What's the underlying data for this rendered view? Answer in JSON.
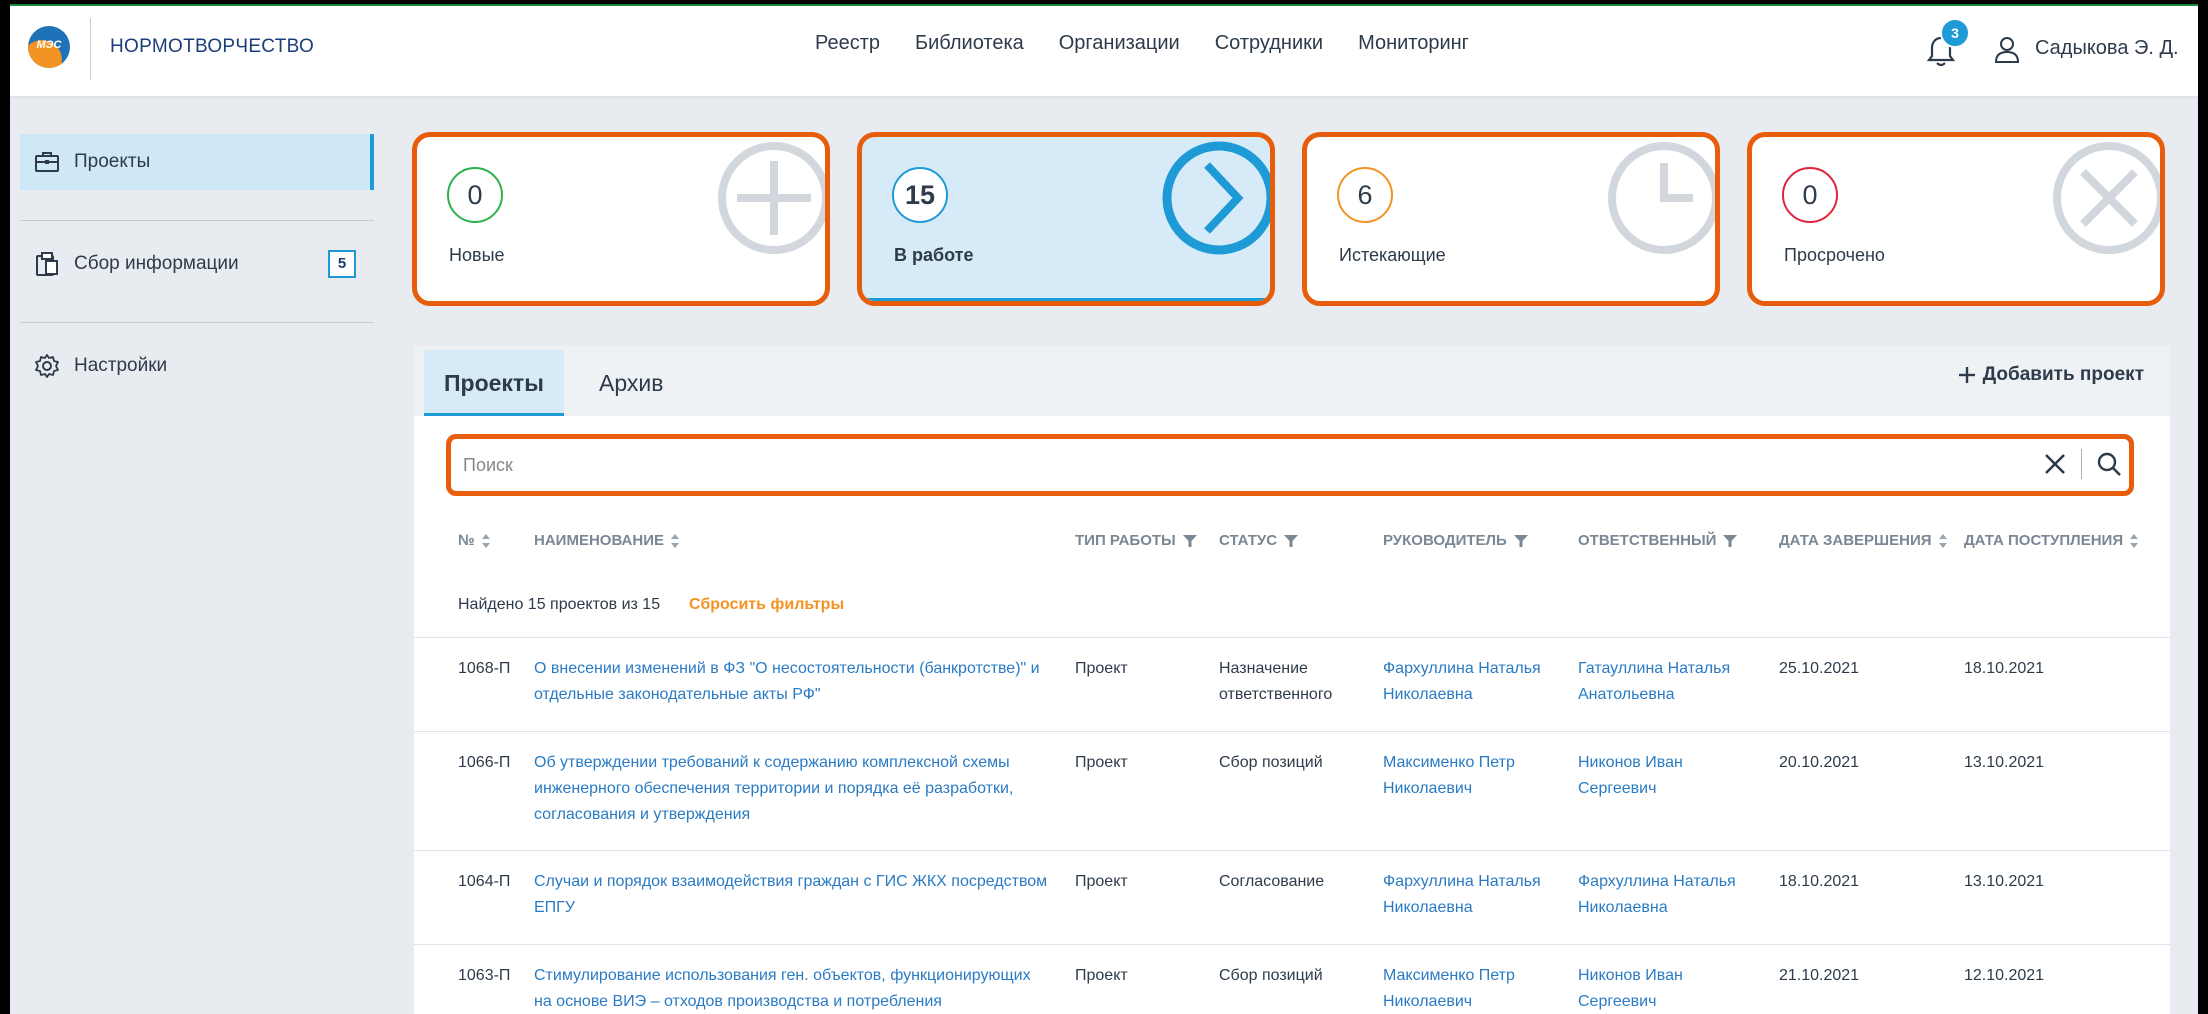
{
  "header": {
    "logo_text": "МЭС",
    "brand": "НОРМОТВОРЧЕСТВО",
    "nav": [
      "Реестр",
      "Библиотека",
      "Организации",
      "Сотрудники",
      "Мониторинг"
    ],
    "notifications_count": "3",
    "user_name": "Садыкова Э. Д."
  },
  "sidebar": {
    "items": [
      {
        "label": "Проекты",
        "icon": "briefcase-icon",
        "active": true
      },
      {
        "label": "Сбор информации",
        "icon": "clipboard-icon",
        "badge": "5"
      },
      {
        "label": "Настройки",
        "icon": "gear-icon"
      }
    ]
  },
  "cards": [
    {
      "count": "0",
      "label": "Новые",
      "icon": "plus-icon",
      "color": "#2bb24c"
    },
    {
      "count": "15",
      "label": "В работе",
      "icon": "chevron-right-icon",
      "color": "#1e9ad6"
    },
    {
      "count": "6",
      "label": "Истекающие",
      "icon": "clock-icon",
      "color": "#f39323"
    },
    {
      "count": "0",
      "label": "Просрочено",
      "icon": "close-icon",
      "color": "#e0243a"
    }
  ],
  "tabs": [
    "Проекты",
    "Архив"
  ],
  "add_project": "Добавить проект",
  "search": {
    "placeholder": "Поиск"
  },
  "table": {
    "columns": [
      "№",
      "НАИМЕНОВАНИЕ",
      "ТИП РАБОТЫ",
      "СТАТУС",
      "РУКОВОДИТЕЛЬ",
      "ОТВЕТСТВЕННЫЙ",
      "ДАТА ЗАВЕРШЕНИЯ",
      "ДАТА ПОСТУПЛЕНИЯ"
    ],
    "found_text": "Найдено 15 проектов из 15",
    "reset_filters": "Сбросить фильтры",
    "rows": [
      {
        "num": "1068-П",
        "name": [
          "О внесении изменений в ФЗ \"О несостоятельности (банкротстве)\" и",
          "отдельные законодательные акты РФ\""
        ],
        "type": "Проект",
        "status": [
          "Назначение",
          "ответственного"
        ],
        "head": [
          "Фархуллина Наталья",
          "Николаевна"
        ],
        "resp": [
          "Гатауллина Наталья",
          "Анатольевна"
        ],
        "end": "25.10.2021",
        "start": "18.10.2021"
      },
      {
        "num": "1066-П",
        "name": [
          "Об утверждении требований к содержанию комплексной схемы",
          "инженерного обеспечения территории и порядка её разработки,",
          "согласования и утверждения"
        ],
        "type": "Проект",
        "status": [
          "Сбор позиций"
        ],
        "head": [
          "Максименко Петр",
          "Николаевич"
        ],
        "resp": [
          "Никонов Иван",
          "Сергеевич"
        ],
        "end": "20.10.2021",
        "start": "13.10.2021"
      },
      {
        "num": "1064-П",
        "name": [
          "Случаи и порядок взаимодействия граждан с ГИС ЖКХ посредством",
          "ЕПГУ"
        ],
        "type": "Проект",
        "status": [
          "Согласование"
        ],
        "head": [
          "Фархуллина Наталья",
          "Николаевна"
        ],
        "resp": [
          "Фархуллина Наталья",
          "Николаевна"
        ],
        "end": "18.10.2021",
        "start": "13.10.2021"
      },
      {
        "num": "1063-П",
        "name": [
          "Стимулирование использования ген. объектов, функционирующих",
          "на основе ВИЭ – отходов производства и потребления"
        ],
        "type": "Проект",
        "status": [
          "Сбор позиций"
        ],
        "head": [
          "Максименко Петр",
          "Николаевич"
        ],
        "resp": [
          "Никонов Иван",
          "Сергеевич"
        ],
        "end": "21.10.2021",
        "start": "12.10.2021"
      }
    ]
  }
}
